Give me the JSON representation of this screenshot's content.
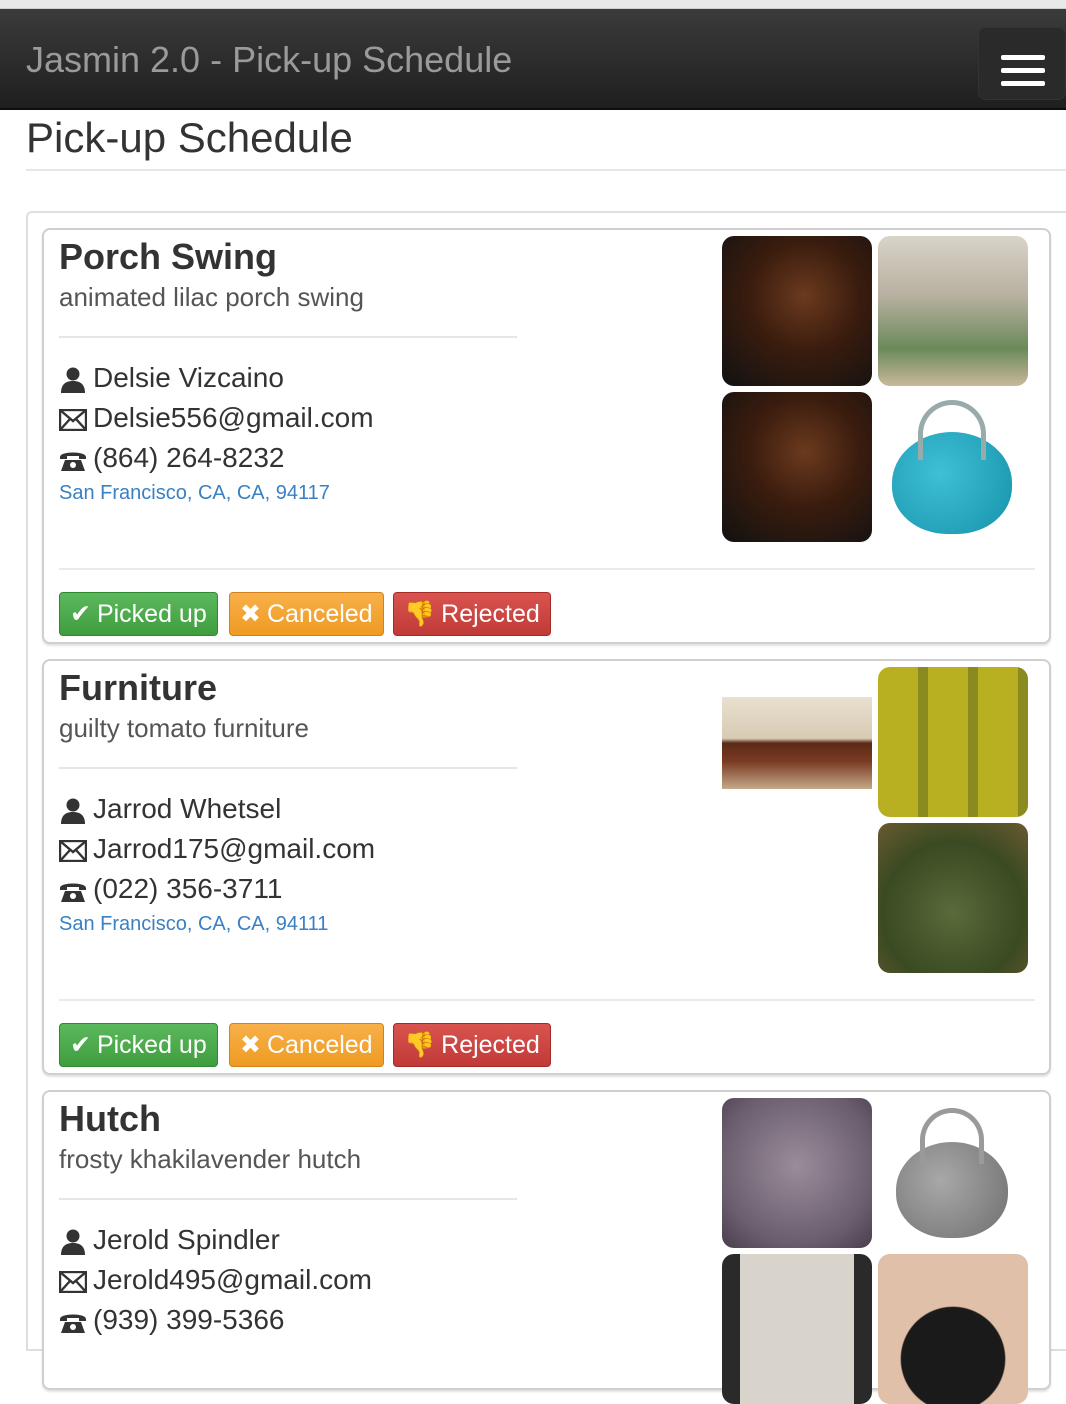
{
  "app": {
    "title": "Jasmin 2.0 - Pick-up Schedule"
  },
  "page": {
    "heading": "Pick-up Schedule"
  },
  "buttons": {
    "picked_up": "Picked up",
    "canceled": "Canceled",
    "rejected": "Rejected"
  },
  "icons": {
    "person": "user-icon",
    "email": "envelope-icon",
    "phone": "phone-icon",
    "check": "check-icon",
    "cancel": "x-icon",
    "reject": "thumbs-down-icon",
    "menu": "hamburger-menu-icon"
  },
  "colors": {
    "green": "#5cb85c",
    "orange": "#f0ad4e",
    "red": "#d9534f",
    "link": "#3a80c4",
    "navbar": "#2b2b2b"
  },
  "items": [
    {
      "title": "Porch Swing",
      "description": "animated lilac porch swing",
      "name": "Delsie Vizcaino",
      "email": "Delsie556@gmail.com",
      "phone": "(864) 264-8232",
      "address": "San Francisco, CA, CA, 94117"
    },
    {
      "title": "Furniture",
      "description": "guilty tomato furniture",
      "name": "Jarrod Whetsel",
      "email": "Jarrod175@gmail.com",
      "phone": "(022) 356-3711",
      "address": "San Francisco, CA, CA, 94111"
    },
    {
      "title": "Hutch",
      "description": "frosty khakilavender hutch",
      "name": "Jerold Spindler",
      "email": "Jerold495@gmail.com",
      "phone": "(939) 399-5366",
      "address": ""
    }
  ]
}
